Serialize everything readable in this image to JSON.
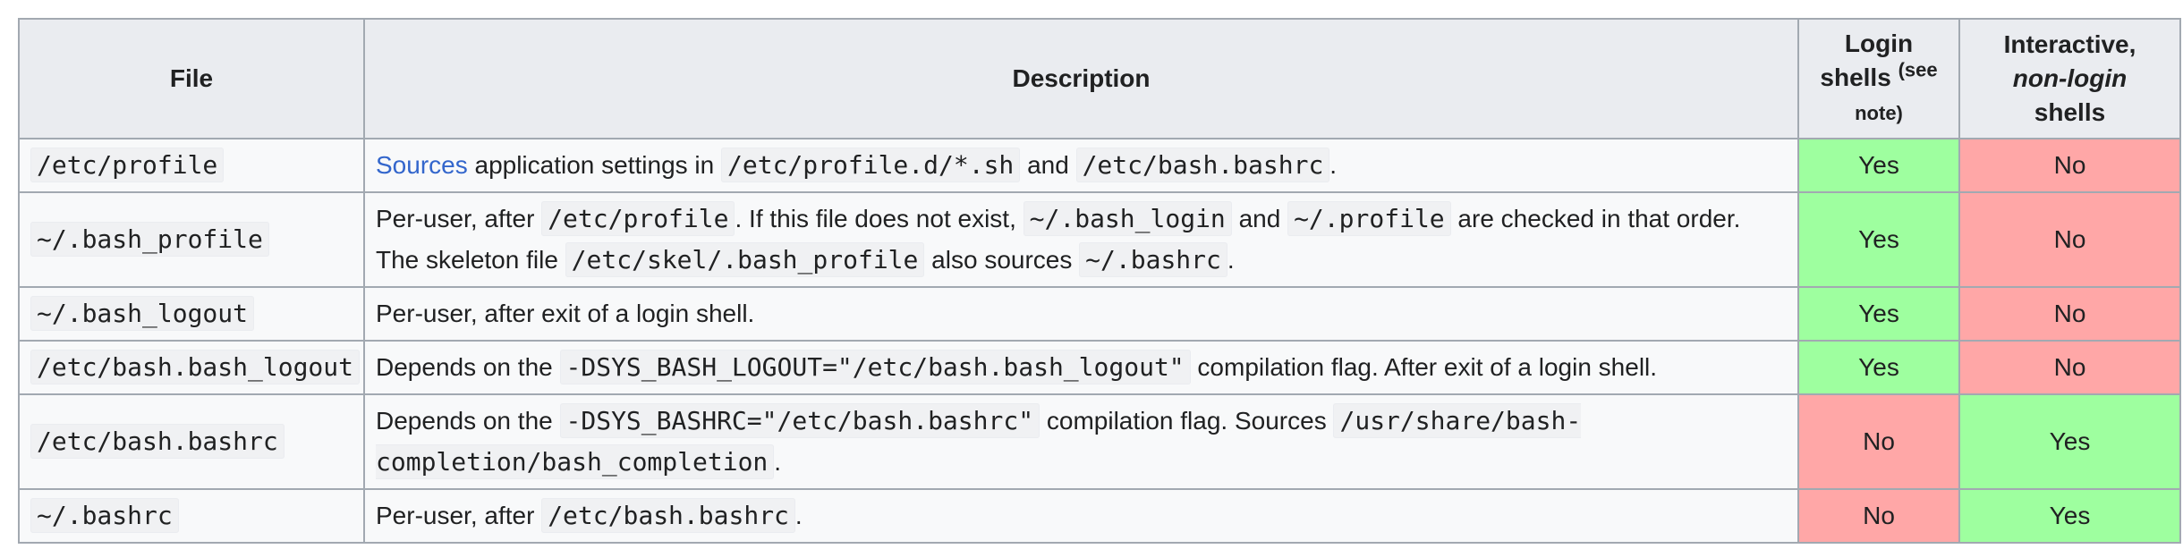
{
  "table": {
    "headers": {
      "file": "File",
      "description": "Description",
      "login_line1": "Login",
      "login_line2": "shells",
      "login_note_open": "(see",
      "login_note_close": "note)",
      "inter_line1": "Interactive,",
      "inter_line2": "non-login",
      "inter_line3": "shells"
    },
    "rows": [
      {
        "file": "/etc/profile",
        "desc": {
          "link": "Sources",
          "t1": " application settings in ",
          "c1": "/etc/profile.d/*.sh",
          "t2": " and ",
          "c2": "/etc/bash.bashrc",
          "t3": "."
        },
        "login": "Yes",
        "interactive": "No"
      },
      {
        "file": "~/.bash_profile",
        "desc": {
          "t1": "Per-user, after ",
          "c1": "/etc/profile",
          "t2": ". If this file does not exist, ",
          "c2": "~/.bash_login",
          "t3": " and ",
          "c3": "~/.profile",
          "t4": " are checked in that order. The skeleton file ",
          "c4": "/etc/skel/.bash_profile",
          "t5": " also sources ",
          "c5": "~/.bashrc",
          "t6": "."
        },
        "login": "Yes",
        "interactive": "No"
      },
      {
        "file": "~/.bash_logout",
        "desc": {
          "t1": "Per-user, after exit of a login shell."
        },
        "login": "Yes",
        "interactive": "No"
      },
      {
        "file": "/etc/bash.bash_logout",
        "desc": {
          "t1": "Depends on the ",
          "c1": "-DSYS_BASH_LOGOUT=\"/etc/bash.bash_logout\"",
          "t2": " compilation flag. After exit of a login shell."
        },
        "login": "Yes",
        "interactive": "No"
      },
      {
        "file": "/etc/bash.bashrc",
        "desc": {
          "t1": "Depends on the ",
          "c1": "-DSYS_BASHRC=\"/etc/bash.bashrc\"",
          "t2": " compilation flag. Sources ",
          "c2": "/usr/share/bash-completion/bash_completion",
          "t3": "."
        },
        "login": "No",
        "interactive": "Yes"
      },
      {
        "file": "~/.bashrc",
        "desc": {
          "t1": "Per-user, after ",
          "c1": "/etc/bash.bashrc",
          "t2": "."
        },
        "login": "No",
        "interactive": "Yes"
      }
    ]
  },
  "colors": {
    "yes_bg": "#9eff9f",
    "no_bg": "#ffa7a7",
    "header_bg": "#eaecf0",
    "cell_bg": "#f8f9fa",
    "border": "#a2a9b1",
    "link": "#3366cc"
  }
}
